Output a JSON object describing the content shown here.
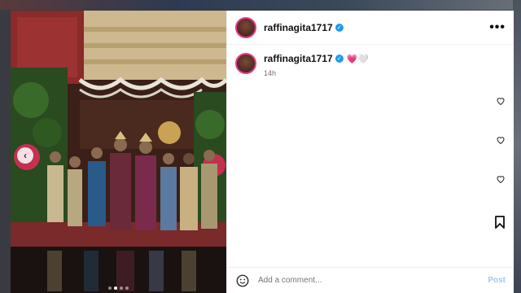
{
  "post": {
    "username": "raffinagita1717",
    "caption_emojis": "💗🤍",
    "time": "14h",
    "more_label": "•••"
  },
  "comment": {
    "placeholder": "Add a comment...",
    "post_label": "Post"
  },
  "icons": {
    "prev": "chevron-left-icon",
    "like": "heart-icon",
    "save": "bookmark-icon",
    "emoji": "smile-icon"
  },
  "colors": {
    "verified": "#1d9bf0",
    "post_button": "#9fc7f5",
    "avatar_ring": "#e23c8c"
  }
}
